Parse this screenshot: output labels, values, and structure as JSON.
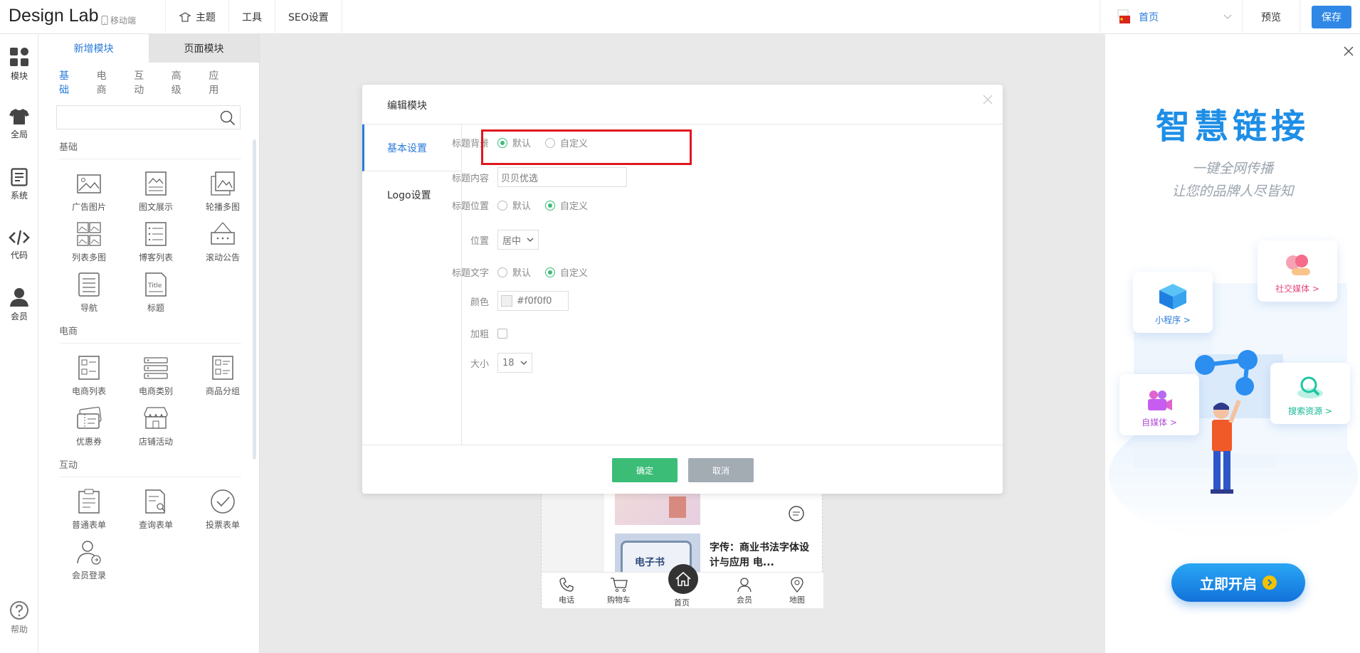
{
  "brand": "Design Lab",
  "mobile_label": "移动端",
  "topnav": [
    {
      "label": "主题",
      "icon": "theme-icon"
    },
    {
      "label": "工具",
      "icon": ""
    },
    {
      "label": "SEO设置",
      "icon": ""
    }
  ],
  "page_selector": {
    "value": "首页",
    "flag_icon": "china-flag-icon"
  },
  "preview_label": "预览",
  "save_label": "保存",
  "rail": [
    {
      "label": "模块",
      "icon": "modules-icon"
    },
    {
      "label": "全局",
      "icon": "shirt-icon"
    },
    {
      "label": "系统",
      "icon": "document-icon"
    },
    {
      "label": "代码",
      "icon": "code-icon"
    },
    {
      "label": "会员",
      "icon": "user-icon"
    },
    {
      "label": "帮助",
      "icon": "help-icon"
    }
  ],
  "panel": {
    "tabs": [
      "新增模块",
      "页面模块"
    ],
    "subtabs": [
      "基础",
      "电商",
      "互动",
      "高级",
      "应用"
    ],
    "sections": [
      {
        "title": "基础",
        "items": [
          "广告图片",
          "图文展示",
          "轮播多图",
          "列表多图",
          "博客列表",
          "滚动公告",
          "导航",
          "标题"
        ]
      },
      {
        "title": "电商",
        "items": [
          "电商列表",
          "电商类别",
          "商品分组",
          "优惠券",
          "店铺活动"
        ]
      },
      {
        "title": "互动",
        "items": [
          "普通表单",
          "查询表单",
          "投票表单",
          "会员登录"
        ]
      }
    ]
  },
  "phone": {
    "article_title": "字传：商业书法字体设计与应用 电...",
    "thumb_text": "电子书",
    "bottom_nav": [
      "电话",
      "购物车",
      "首页",
      "会员",
      "地图"
    ]
  },
  "modal": {
    "title": "编辑模块",
    "side": [
      "基本设置",
      "Logo设置"
    ],
    "rows": {
      "bg_label": "标题背景",
      "bg_options": [
        "默认",
        "自定义"
      ],
      "content_label": "标题内容",
      "content_value": "贝贝优选",
      "position_label": "标题位置",
      "position_options": [
        "默认",
        "自定义"
      ],
      "align_label": "位置",
      "align_value": "居中",
      "text_label": "标题文字",
      "text_options": [
        "默认",
        "自定义"
      ],
      "color_label": "颜色",
      "color_value": "#f0f0f0",
      "bold_label": "加粗",
      "size_label": "大小",
      "size_value": "18"
    },
    "ok_label": "确定",
    "cancel_label": "取消"
  },
  "ad": {
    "title": "智慧链接",
    "sub1": "一键全网传播",
    "sub2": "让您的品牌人尽皆知",
    "cards": [
      "社交媒体 >",
      "小程序 >",
      "自媒体 >",
      "搜索资源 >"
    ],
    "button": "立即开启"
  },
  "colors": {
    "accent": "#2a7bd9",
    "green": "#3bbd78",
    "highlight": "#e0171f",
    "ad_blue": "#1e8ee6"
  }
}
